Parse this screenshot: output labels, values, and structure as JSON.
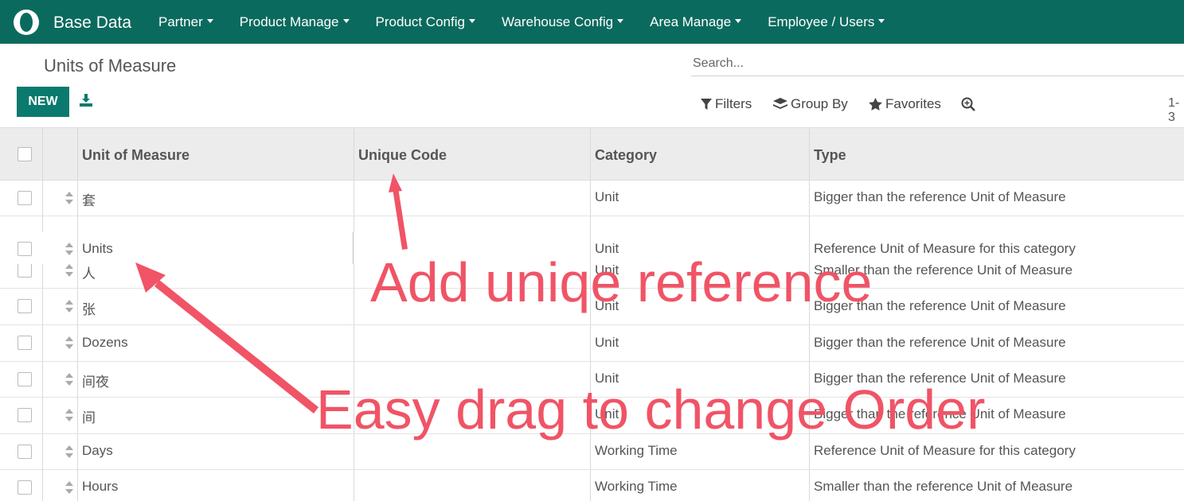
{
  "navbar": {
    "app_name": "Base Data",
    "menu": [
      "Partner",
      "Product Manage",
      "Product Config",
      "Warehouse Config",
      "Area Manage",
      "Employee / Users"
    ]
  },
  "control_panel": {
    "page_title": "Units of Measure",
    "new_label": "NEW",
    "search_placeholder": "Search...",
    "filters_label": "Filters",
    "group_by_label": "Group By",
    "favorites_label": "Favorites",
    "pager": "1-3"
  },
  "table": {
    "columns": [
      "Unit of Measure",
      "Unique Code",
      "Category",
      "Type"
    ],
    "rows": [
      {
        "name": "套",
        "code": "",
        "category": "Unit",
        "type": "Bigger than the reference Unit of Measure"
      },
      {
        "name": "Units",
        "code": "",
        "category": "Unit",
        "type": "Reference Unit of Measure for this category"
      },
      {
        "name": "人",
        "code": "",
        "category": "Unit",
        "type": "Smaller than the reference Unit of Measure"
      },
      {
        "name": "张",
        "code": "",
        "category": "Unit",
        "type": "Bigger than the reference Unit of Measure"
      },
      {
        "name": "Dozens",
        "code": "",
        "category": "Unit",
        "type": "Bigger than the reference Unit of Measure"
      },
      {
        "name": "间夜",
        "code": "",
        "category": "Unit",
        "type": "Bigger than the reference Unit of Measure"
      },
      {
        "name": "间",
        "code": "",
        "category": "Unit",
        "type": "Bigger than the reference Unit of Measure"
      },
      {
        "name": "Days",
        "code": "",
        "category": "Working Time",
        "type": "Reference Unit of Measure for this category"
      },
      {
        "name": "Hours",
        "code": "",
        "category": "Working Time",
        "type": "Smaller than the reference Unit of Measure"
      }
    ]
  },
  "annotations": {
    "unique_reference": "Add uniqe reference",
    "drag_order": "Easy drag to change Order"
  },
  "colors": {
    "navbar": "#0b6a5e",
    "primary_button": "#0b7a6e",
    "annotation": "#f05466"
  }
}
